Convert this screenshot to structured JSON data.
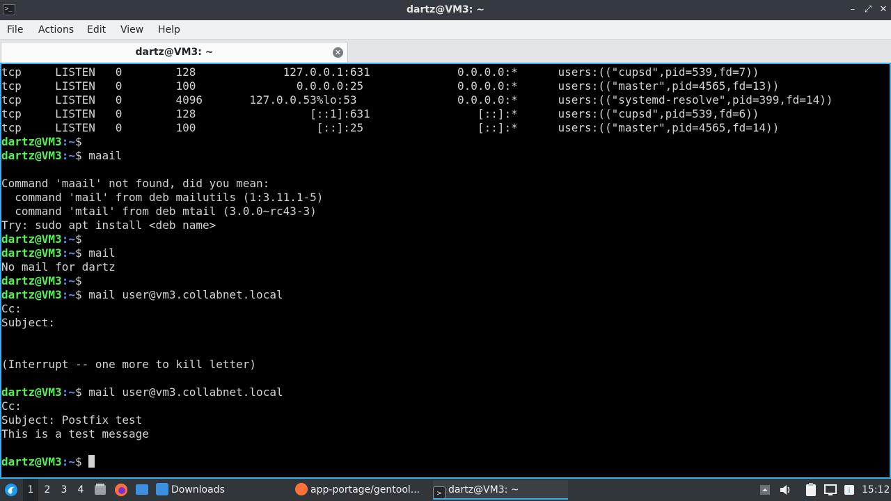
{
  "window": {
    "title": "dartz@VM3: ~",
    "controls": [
      "minimize",
      "maximize",
      "close"
    ]
  },
  "menu": [
    "File",
    "Actions",
    "Edit",
    "View",
    "Help"
  ],
  "tab": {
    "label": "dartz@VM3: ~"
  },
  "terminal": {
    "prompt_user": "dartz@VM3",
    "prompt_path": ":~",
    "prompt_symbol": "$ ",
    "lines": [
      {
        "type": "output",
        "text": "tcp     LISTEN   0        128             127.0.0.1:631             0.0.0.0:*      users:((\"cupsd\",pid=539,fd=7))"
      },
      {
        "type": "output",
        "text": "tcp     LISTEN   0        100               0.0.0.0:25              0.0.0.0:*      users:((\"master\",pid=4565,fd=13))"
      },
      {
        "type": "output",
        "text": "tcp     LISTEN   0        4096       127.0.0.53%lo:53               0.0.0.0:*      users:((\"systemd-resolve\",pid=399,fd=14))"
      },
      {
        "type": "output",
        "text": "tcp     LISTEN   0        128                 [::1]:631                [::]:*      users:((\"cupsd\",pid=539,fd=6))"
      },
      {
        "type": "output",
        "text": "tcp     LISTEN   0        100                  [::]:25                 [::]:*      users:((\"master\",pid=4565,fd=14))"
      },
      {
        "type": "prompt",
        "command": ""
      },
      {
        "type": "prompt",
        "command": "maail"
      },
      {
        "type": "output",
        "text": ""
      },
      {
        "type": "output",
        "text": "Command 'maail' not found, did you mean:"
      },
      {
        "type": "output",
        "text": "  command 'mail' from deb mailutils (1:3.11.1-5)"
      },
      {
        "type": "output",
        "text": "  command 'mtail' from deb mtail (3.0.0~rc43-3)"
      },
      {
        "type": "output",
        "text": "Try: sudo apt install <deb name>"
      },
      {
        "type": "prompt",
        "command": ""
      },
      {
        "type": "prompt",
        "command": "mail"
      },
      {
        "type": "output",
        "text": "No mail for dartz"
      },
      {
        "type": "prompt",
        "command": ""
      },
      {
        "type": "prompt",
        "command": "mail user@vm3.collabnet.local"
      },
      {
        "type": "output",
        "text": "Cc:"
      },
      {
        "type": "output",
        "text": "Subject:"
      },
      {
        "type": "output",
        "text": ""
      },
      {
        "type": "output",
        "text": ""
      },
      {
        "type": "output",
        "text": "(Interrupt -- one more to kill letter)"
      },
      {
        "type": "output",
        "text": ""
      },
      {
        "type": "prompt",
        "command": "mail user@vm3.collabnet.local"
      },
      {
        "type": "output",
        "text": "Cc:"
      },
      {
        "type": "output",
        "text": "Subject: Postfix test"
      },
      {
        "type": "output",
        "text": "This is a test message"
      },
      {
        "type": "output",
        "text": ""
      },
      {
        "type": "prompt",
        "command": "",
        "cursor": true
      }
    ]
  },
  "taskbar": {
    "desktops": [
      "1",
      "2",
      "3",
      "4"
    ],
    "active_desktop": "1",
    "tasks": [
      {
        "label": "Downloads",
        "icon": "folder-icon",
        "active": false
      },
      {
        "label": "app-portage/gentool...",
        "icon": "firefox-icon",
        "active": false
      },
      {
        "label": "dartz@VM3: ~",
        "icon": "terminal-icon",
        "active": true
      }
    ],
    "clock": "15:12",
    "colors": {
      "accent": "#3daee9",
      "prompt_user": "#54f254",
      "prompt_path": "#5c93ff"
    }
  }
}
